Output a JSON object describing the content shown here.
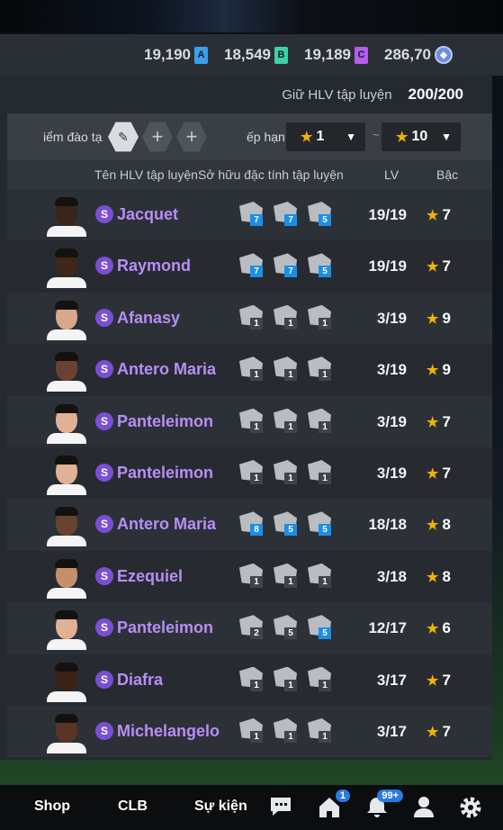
{
  "currencies": [
    {
      "value": "19,190",
      "badge": "A",
      "color": "#3aa0ea"
    },
    {
      "value": "18,549",
      "badge": "B",
      "color": "#3ed0a6"
    },
    {
      "value": "19,189",
      "badge": "C",
      "color": "#b65ce8"
    },
    {
      "value": "286,70",
      "badge": "",
      "color": "#6d8fd8"
    }
  ],
  "keep": {
    "label": "Giữ HLV tập luyện",
    "value": "200/200"
  },
  "filter": {
    "training_label": "iểm đào tạ",
    "rank_label": "ếp hạn",
    "from": "1",
    "to": "10",
    "separator": "~"
  },
  "columns": {
    "name": "Tên HLV tập luyện",
    "traits": "Sở hữu đặc tính tập luyện",
    "lv": "LV",
    "grade": "Bậc"
  },
  "coaches": [
    {
      "name": "Jacquet",
      "traits": [
        "7",
        "7",
        "5"
      ],
      "blue": [
        true,
        true,
        true
      ],
      "lv": "19/19",
      "grade": "7",
      "skin": "#3b2418"
    },
    {
      "name": "Raymond",
      "traits": [
        "7",
        "7",
        "5"
      ],
      "blue": [
        true,
        true,
        true
      ],
      "lv": "19/19",
      "grade": "7",
      "skin": "#3e2619"
    },
    {
      "name": "Afanasy",
      "traits": [
        "1",
        "1",
        "1"
      ],
      "blue": [
        false,
        false,
        false
      ],
      "lv": "3/19",
      "grade": "9",
      "skin": "#d9a88a"
    },
    {
      "name": "Antero Maria",
      "traits": [
        "1",
        "1",
        "1"
      ],
      "blue": [
        false,
        false,
        false
      ],
      "lv": "3/19",
      "grade": "9",
      "skin": "#6a4330"
    },
    {
      "name": "Panteleimon",
      "traits": [
        "1",
        "1",
        "1"
      ],
      "blue": [
        false,
        false,
        false
      ],
      "lv": "3/19",
      "grade": "7",
      "skin": "#e0b195"
    },
    {
      "name": "Panteleimon",
      "traits": [
        "1",
        "1",
        "1"
      ],
      "blue": [
        false,
        false,
        false
      ],
      "lv": "3/19",
      "grade": "7",
      "skin": "#e0b195"
    },
    {
      "name": "Antero Maria",
      "traits": [
        "8",
        "5",
        "5"
      ],
      "blue": [
        true,
        true,
        true
      ],
      "lv": "18/18",
      "grade": "8",
      "skin": "#6a4330"
    },
    {
      "name": "Ezequiel",
      "traits": [
        "1",
        "1",
        "1"
      ],
      "blue": [
        false,
        false,
        false
      ],
      "lv": "3/18",
      "grade": "8",
      "skin": "#c58f6c"
    },
    {
      "name": "Panteleimon",
      "traits": [
        "2",
        "5",
        "5"
      ],
      "blue": [
        false,
        false,
        true
      ],
      "lv": "12/17",
      "grade": "6",
      "skin": "#e0b195"
    },
    {
      "name": "Diafra",
      "traits": [
        "1",
        "1",
        "1"
      ],
      "blue": [
        false,
        false,
        false
      ],
      "lv": "3/17",
      "grade": "7",
      "skin": "#3a2217"
    },
    {
      "name": "Michelangelo",
      "traits": [
        "1",
        "1",
        "1"
      ],
      "blue": [
        false,
        false,
        false
      ],
      "lv": "3/17",
      "grade": "7",
      "skin": "#5a3524"
    }
  ],
  "nav": {
    "shop": "Shop",
    "clb": "CLB",
    "events": "Sự kiện",
    "home_badge": "1",
    "bell_badge": "99+"
  },
  "icons": {
    "chat": "chat-icon",
    "home": "home-icon",
    "bell": "bell-icon",
    "profile": "profile-icon",
    "settings": "gear-icon"
  }
}
